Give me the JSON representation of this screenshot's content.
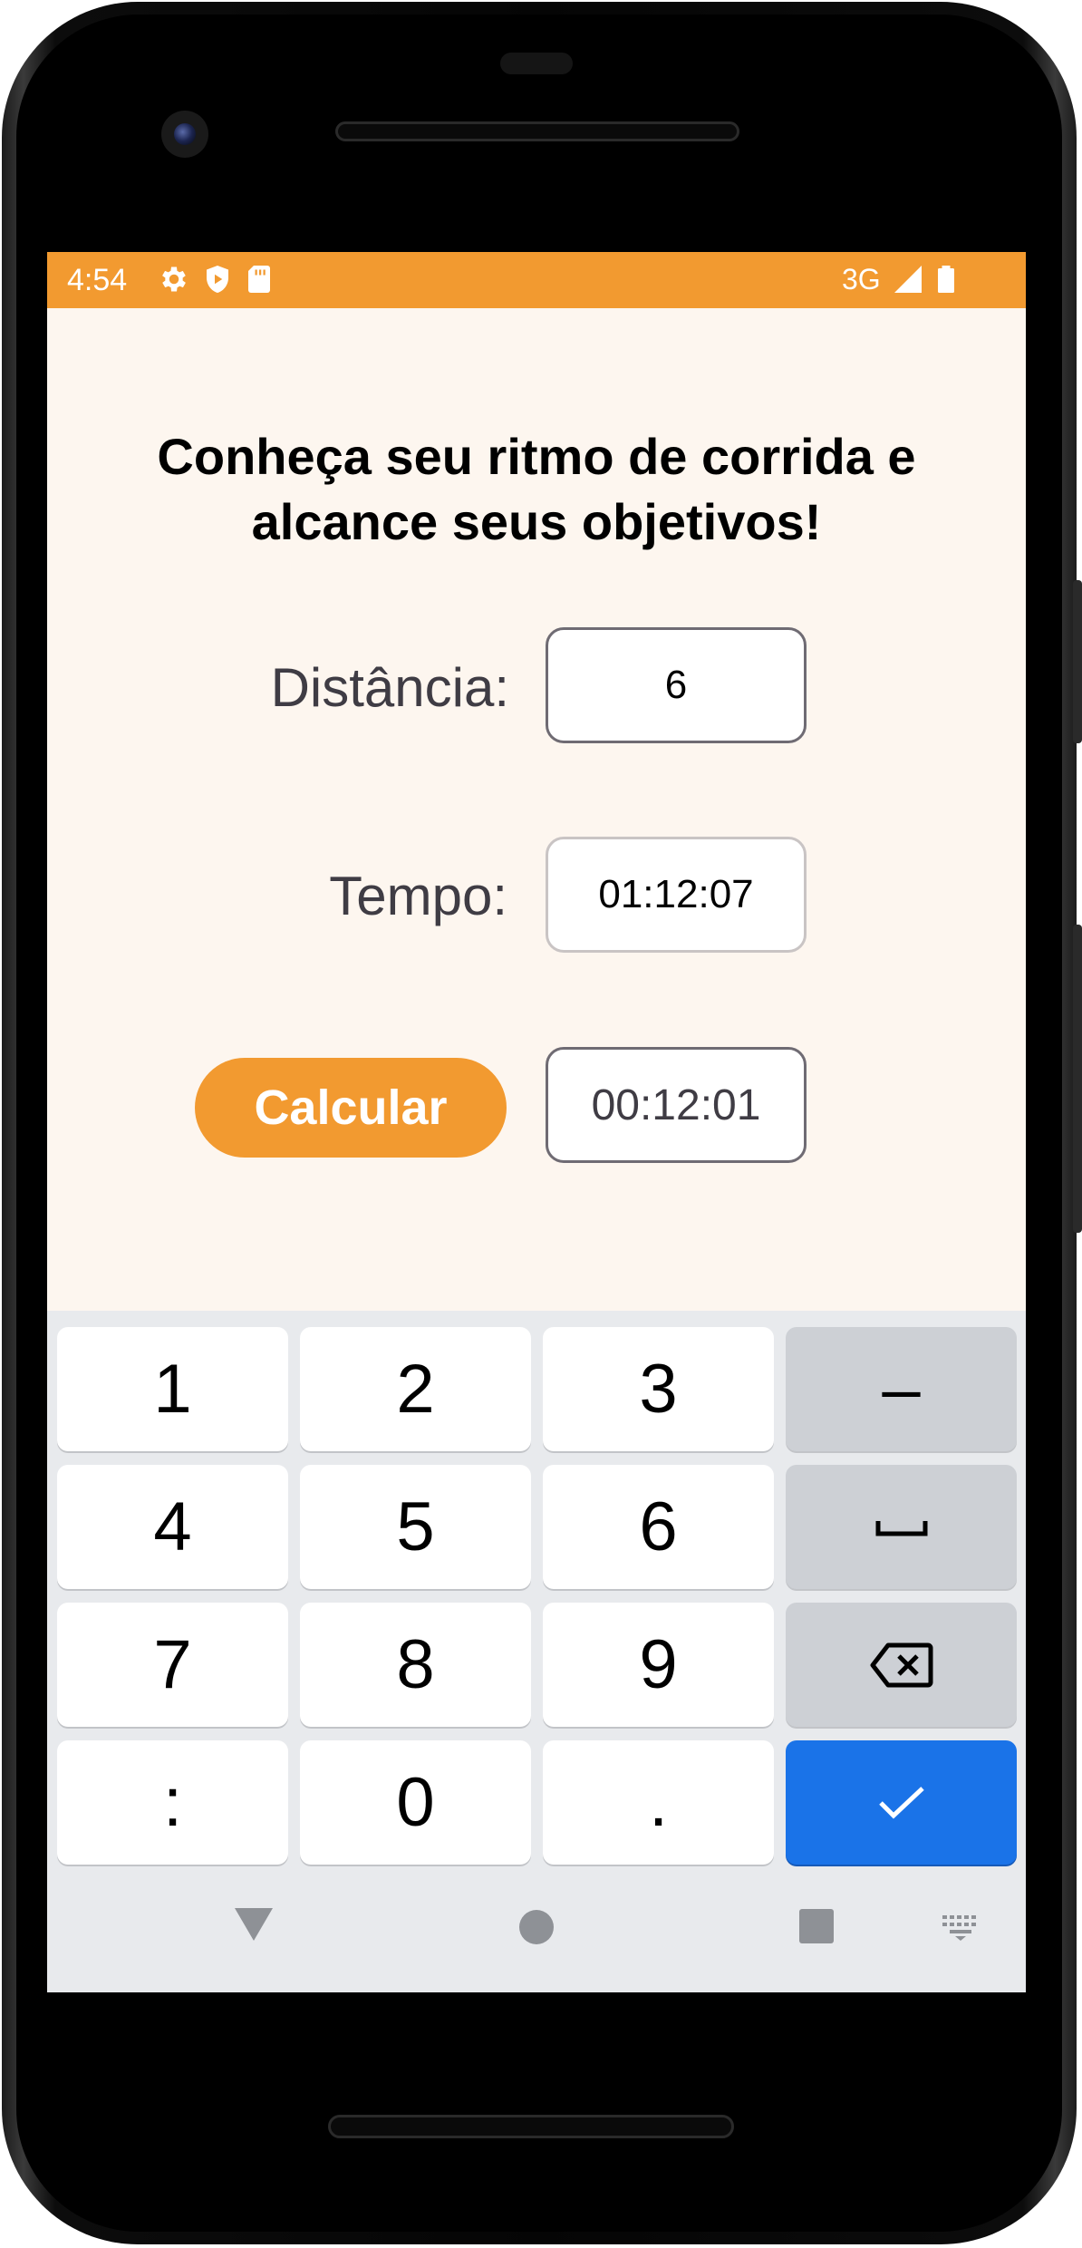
{
  "status_bar": {
    "time": "4:54",
    "network": "3G",
    "icons": [
      "gear-icon",
      "shield-play-icon",
      "sd-card-icon",
      "signal-icon",
      "battery-icon"
    ],
    "color": "#f29a30"
  },
  "app": {
    "headline_line1": "Conheça seu ritmo de corrida e",
    "headline_line2": "alcance seus objetivos!",
    "distance_label": "Distância:",
    "distance_value": "6",
    "time_label": "Tempo:",
    "time_value": "01:12:07",
    "calculate_label": "Calcular",
    "result_value": "00:12:01",
    "background_color": "#fdf6ef",
    "accent_color": "#f29a30"
  },
  "keyboard": {
    "keys": [
      "1",
      "2",
      "3",
      "–",
      "4",
      "5",
      "6",
      "␣",
      "7",
      "8",
      "9",
      "⌫",
      ":",
      "0",
      ".",
      "✓"
    ],
    "enter_color": "#1a73e8"
  },
  "nav_bar": {
    "icons": [
      "back-icon",
      "home-icon",
      "recents-icon",
      "keyboard-switch-icon"
    ]
  }
}
